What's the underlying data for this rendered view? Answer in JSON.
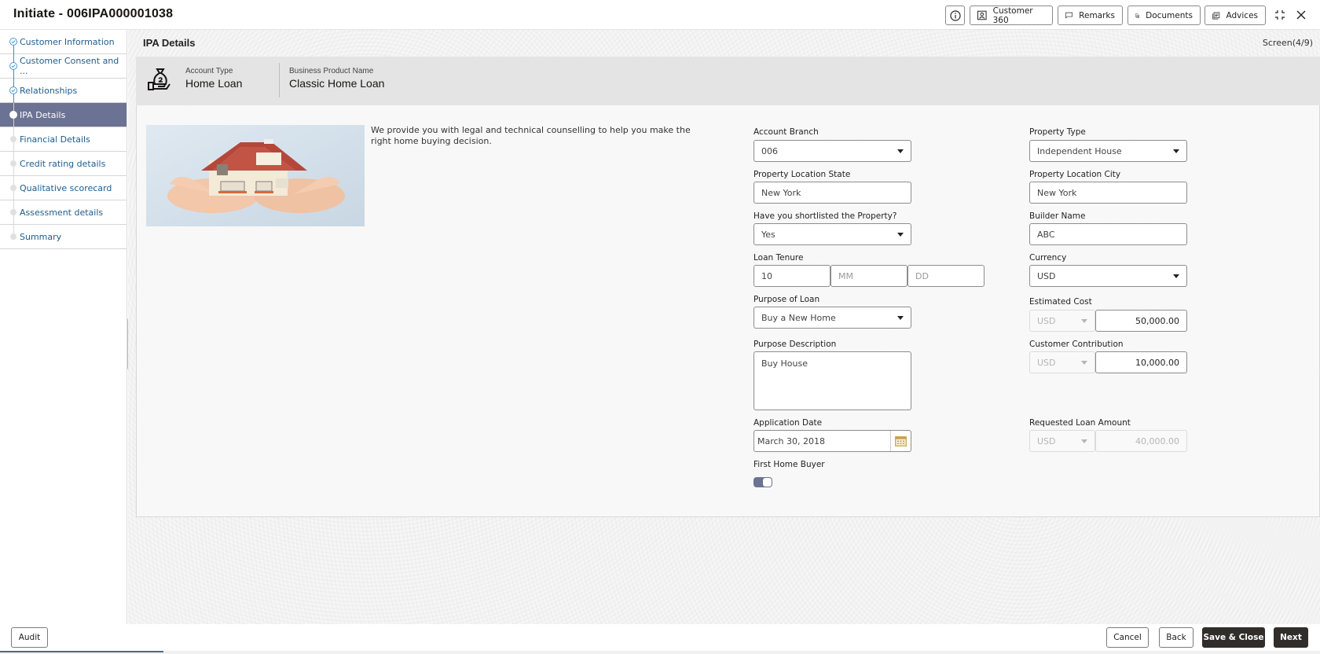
{
  "header": {
    "title": "Initiate - 006IPA000001038",
    "buttons": {
      "info_icon": "info-icon",
      "customer360": "Customer 360",
      "remarks": "Remarks",
      "documents": "Documents",
      "advices": "Advices"
    },
    "icons": [
      "info-icon",
      "user-icon",
      "comment-icon",
      "document-icon",
      "advices-icon",
      "collapse-icon",
      "close-icon"
    ]
  },
  "sidebar": {
    "items": [
      {
        "label": "Customer Information",
        "status": "done"
      },
      {
        "label": "Customer Consent and ...",
        "status": "done"
      },
      {
        "label": "Relationships",
        "status": "done"
      },
      {
        "label": "IPA Details",
        "status": "current"
      },
      {
        "label": "Financial Details",
        "status": "pending"
      },
      {
        "label": "Credit rating details",
        "status": "pending"
      },
      {
        "label": "Qualitative scorecard",
        "status": "pending"
      },
      {
        "label": "Assessment details",
        "status": "pending"
      },
      {
        "label": "Summary",
        "status": "pending"
      }
    ]
  },
  "main": {
    "page_title": "IPA Details",
    "screen_counter": "Screen(4/9)",
    "info_bar": {
      "icon": "money-bag-hand-icon",
      "account_type_label": "Account Type",
      "account_type_value": "Home Loan",
      "product_label": "Business Product Name",
      "product_value": "Classic Home Loan"
    },
    "hero": {
      "image": "house-in-hands-image",
      "text": "We provide you with legal and technical counselling to help you make the right home buying decision."
    },
    "form": {
      "account_branch": {
        "label": "Account Branch",
        "value": "006"
      },
      "property_type": {
        "label": "Property Type",
        "value": "Independent House"
      },
      "property_location_state": {
        "label": "Property Location State",
        "value": "New York"
      },
      "property_location_city": {
        "label": "Property Location City",
        "value": "New York"
      },
      "shortlisted": {
        "label": "Have you shortlisted the Property?",
        "value": "Yes"
      },
      "builder_name": {
        "label": "Builder Name",
        "value": "ABC"
      },
      "loan_tenure": {
        "label": "Loan Tenure",
        "years": "10",
        "months_placeholder": "MM",
        "days_placeholder": "DD"
      },
      "currency": {
        "label": "Currency",
        "value": "USD"
      },
      "purpose_of_loan": {
        "label": "Purpose of Loan",
        "value": "Buy a New Home"
      },
      "estimated_cost": {
        "label": "Estimated Cost",
        "currency": "USD",
        "amount": "50,000.00"
      },
      "purpose_description": {
        "label": "Purpose Description",
        "value": "Buy House"
      },
      "customer_contribution": {
        "label": "Customer Contribution",
        "currency": "USD",
        "amount": "10,000.00"
      },
      "application_date": {
        "label": "Application Date",
        "value": "March 30, 2018"
      },
      "requested_loan_amount": {
        "label": "Requested Loan Amount",
        "currency": "USD",
        "amount": "40,000.00"
      },
      "first_home_buyer": {
        "label": "First Home Buyer",
        "value": true
      }
    }
  },
  "footer": {
    "audit": "Audit",
    "cancel": "Cancel",
    "back": "Back",
    "save_close": "Save & Close",
    "next": "Next"
  },
  "colors": {
    "accent": "#6b7293",
    "link": "#1e5d8c",
    "dark_button": "#312d2a",
    "calendar_icon": "#c9a04a"
  }
}
